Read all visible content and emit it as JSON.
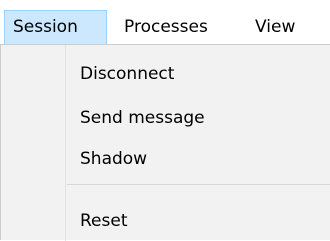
{
  "menubar": {
    "items": [
      {
        "label": "Session"
      },
      {
        "label": "Processes"
      },
      {
        "label": "View"
      }
    ]
  },
  "session_menu": {
    "items": [
      {
        "label": "Disconnect"
      },
      {
        "label": "Send message"
      },
      {
        "label": "Shadow"
      },
      {
        "label": "Reset"
      }
    ]
  }
}
